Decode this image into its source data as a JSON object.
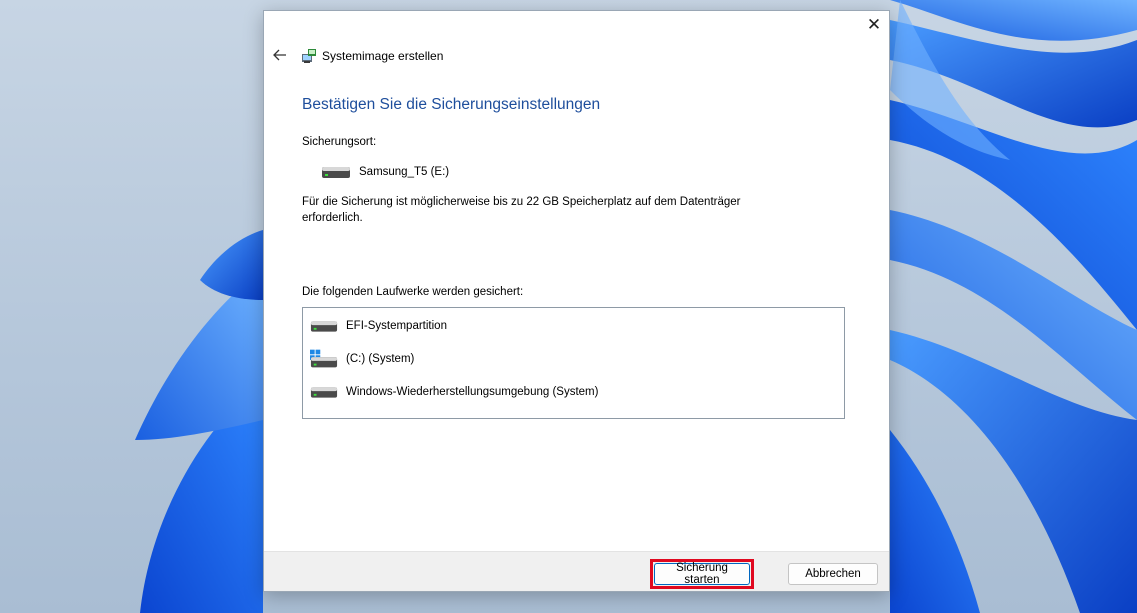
{
  "window": {
    "title": "Systemimage erstellen",
    "close_icon": "close-icon",
    "back_icon": "back-arrow-icon",
    "title_icon": "system-image-icon"
  },
  "heading": "Bestätigen Sie die Sicherungseinstellungen",
  "destination": {
    "label": "Sicherungsort:",
    "drive_name": "Samsung_T5 (E:)",
    "drive_icon": "drive-icon"
  },
  "space_info": "Für die Sicherung ist möglicherweise bis zu 22 GB Speicherplatz auf dem Datenträger erforderlich.",
  "drives": {
    "label": "Die folgenden Laufwerke werden gesichert:",
    "items": [
      {
        "label": "EFI-Systempartition",
        "icon": "drive-icon"
      },
      {
        "label": "(C:) (System)",
        "icon": "windows-drive-icon"
      },
      {
        "label": "Windows-Wiederherstellungsumgebung (System)",
        "icon": "drive-icon"
      }
    ]
  },
  "buttons": {
    "start": "Sicherung starten",
    "cancel": "Abbrechen"
  },
  "colors": {
    "heading": "#1e4e9c",
    "highlight": "#e0081f",
    "wallpaper_blue": "#1565e8"
  }
}
